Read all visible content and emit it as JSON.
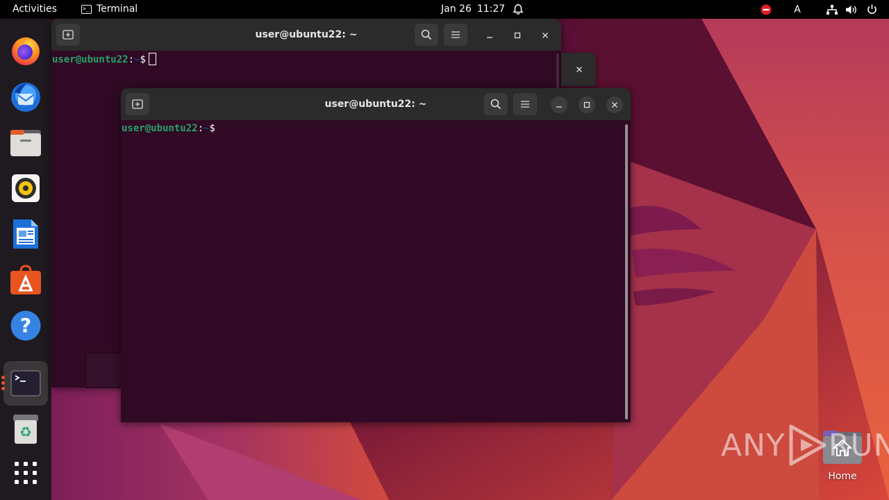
{
  "topbar": {
    "activities": "Activities",
    "app_name": "Terminal",
    "date": "Jan 26",
    "time": "11:27",
    "input_indicator": "A"
  },
  "dock": {
    "items": [
      {
        "name": "firefox",
        "icon": "firefox-icon"
      },
      {
        "name": "thunderbird",
        "icon": "thunderbird-icon"
      },
      {
        "name": "files",
        "icon": "files-icon"
      },
      {
        "name": "rhythmbox",
        "icon": "rhythmbox-icon"
      },
      {
        "name": "libreoffice-writer",
        "icon": "writer-icon"
      },
      {
        "name": "app-center",
        "icon": "app-center-icon"
      },
      {
        "name": "help",
        "icon": "help-icon"
      },
      {
        "name": "terminal",
        "icon": "terminal-icon",
        "running": true
      },
      {
        "name": "trash",
        "icon": "trash-icon"
      },
      {
        "name": "show-apps",
        "icon": "show-apps-icon"
      }
    ]
  },
  "windows": {
    "back": {
      "title": "user@ubuntu22: ~",
      "prompt_user": "user@ubuntu22",
      "prompt_sep": ":",
      "prompt_path": "~",
      "prompt_symbol": "$"
    },
    "front": {
      "title": "user@ubuntu22: ~",
      "prompt_user": "user@ubuntu22",
      "prompt_sep": ":",
      "prompt_path": "~",
      "prompt_symbol": "$"
    }
  },
  "desktop": {
    "home_label": "Home"
  },
  "watermark": {
    "text_left": "ANY",
    "text_right": "RUN"
  },
  "colors": {
    "terminal_bg": "#300a24",
    "prompt_user": "#26a269",
    "prompt_path": "#12488b",
    "accent": "#e95420"
  }
}
